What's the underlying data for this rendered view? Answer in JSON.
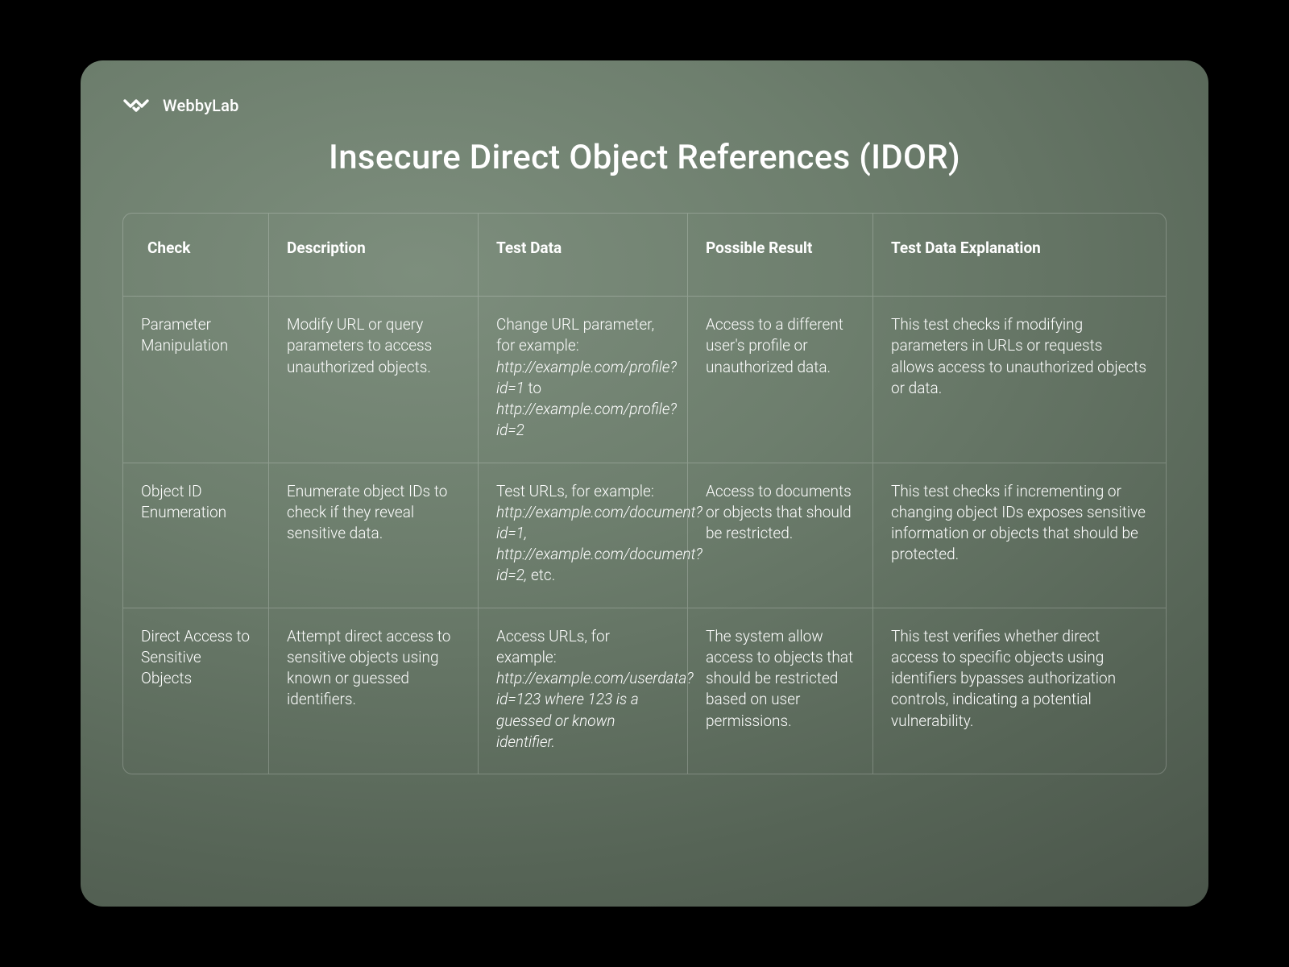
{
  "brand": "WebbyLab",
  "title": "Insecure Direct Object References (IDOR)",
  "columns": [
    "Check",
    "Description",
    "Test Data",
    "Possible Result",
    "Test Data Explanation"
  ],
  "rows": [
    {
      "check": "Parameter Manipulation",
      "description": "Modify URL or query parameters to access unauthorized objects.",
      "test_data_html": "Change URL parameter, for example: <em>http://example.com/profile?id=1</em> to <em>http://example.com/profile?id=2</em>",
      "possible_result": "Access to a different user's profile or unauthorized data.",
      "explanation": "This test checks if modifying parameters in URLs or requests allows access to unauthorized objects or data."
    },
    {
      "check": "Object ID Enumeration",
      "description": "Enumerate object IDs to check if they reveal sensitive data.",
      "test_data_html": "Test URLs, for example: <em>http://example.com/document?id=1, http://example.com/document?id=2,</em> etc.",
      "possible_result": "Access to documents or objects that should be restricted.",
      "explanation": "This test checks if incrementing or changing object IDs exposes sensitive information or objects that should be protected."
    },
    {
      "check": "Direct Access to Sensitive Objects",
      "description": "Attempt direct access to sensitive objects using known or guessed identifiers.",
      "test_data_html": "Access URLs, for example: <em>http://example.com/userdata?id=123 where 123 is a guessed or known identifier.</em>",
      "possible_result": "The system allow access to objects that should be restricted based on user permissions.",
      "explanation": "This test verifies whether direct access to specific objects using identifiers bypasses authorization controls, indicating a potential vulnerability."
    }
  ]
}
